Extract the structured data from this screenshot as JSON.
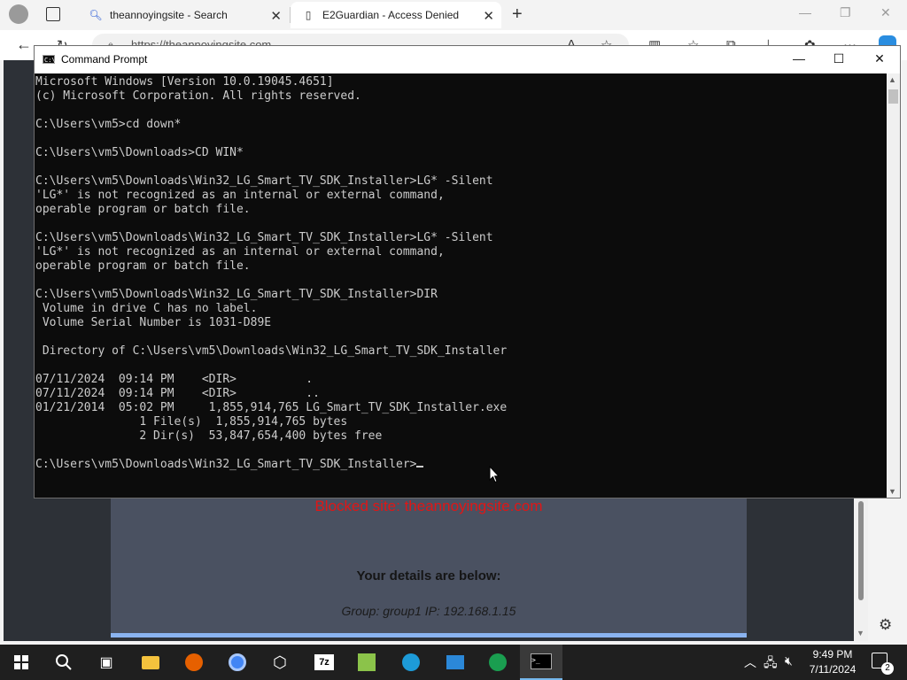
{
  "browser": {
    "tabs": [
      {
        "title": "theannoyingsite - Search"
      },
      {
        "title": "E2Guardian - Access Denied"
      }
    ],
    "address": "https://theannoyingsite.com",
    "page": {
      "blocked_text": "Blocked site: theannoyingsite.com",
      "details_heading": "Your details are below:",
      "group_ip": "Group: group1   IP: 192.168.1.15"
    }
  },
  "cmd": {
    "title": "Command Prompt",
    "lines": [
      "Microsoft Windows [Version 10.0.19045.4651]",
      "(c) Microsoft Corporation. All rights reserved.",
      "",
      "C:\\Users\\vm5>cd down*",
      "",
      "C:\\Users\\vm5\\Downloads>CD WIN*",
      "",
      "C:\\Users\\vm5\\Downloads\\Win32_LG_Smart_TV_SDK_Installer>LG* -Silent",
      "'LG*' is not recognized as an internal or external command,",
      "operable program or batch file.",
      "",
      "C:\\Users\\vm5\\Downloads\\Win32_LG_Smart_TV_SDK_Installer>LG* -Silent",
      "'LG*' is not recognized as an internal or external command,",
      "operable program or batch file.",
      "",
      "C:\\Users\\vm5\\Downloads\\Win32_LG_Smart_TV_SDK_Installer>DIR",
      " Volume in drive C has no label.",
      " Volume Serial Number is 1031-D89E",
      "",
      " Directory of C:\\Users\\vm5\\Downloads\\Win32_LG_Smart_TV_SDK_Installer",
      "",
      "07/11/2024  09:14 PM    <DIR>          .",
      "07/11/2024  09:14 PM    <DIR>          ..",
      "01/21/2014  05:02 PM     1,855,914,765 LG_Smart_TV_SDK_Installer.exe",
      "               1 File(s)  1,855,914,765 bytes",
      "               2 Dir(s)  53,847,654,400 bytes free",
      "",
      "C:\\Users\\vm5\\Downloads\\Win32_LG_Smart_TV_SDK_Installer>"
    ]
  },
  "taskbar": {
    "time": "9:49 PM",
    "date": "7/11/2024",
    "notification_count": "2"
  }
}
